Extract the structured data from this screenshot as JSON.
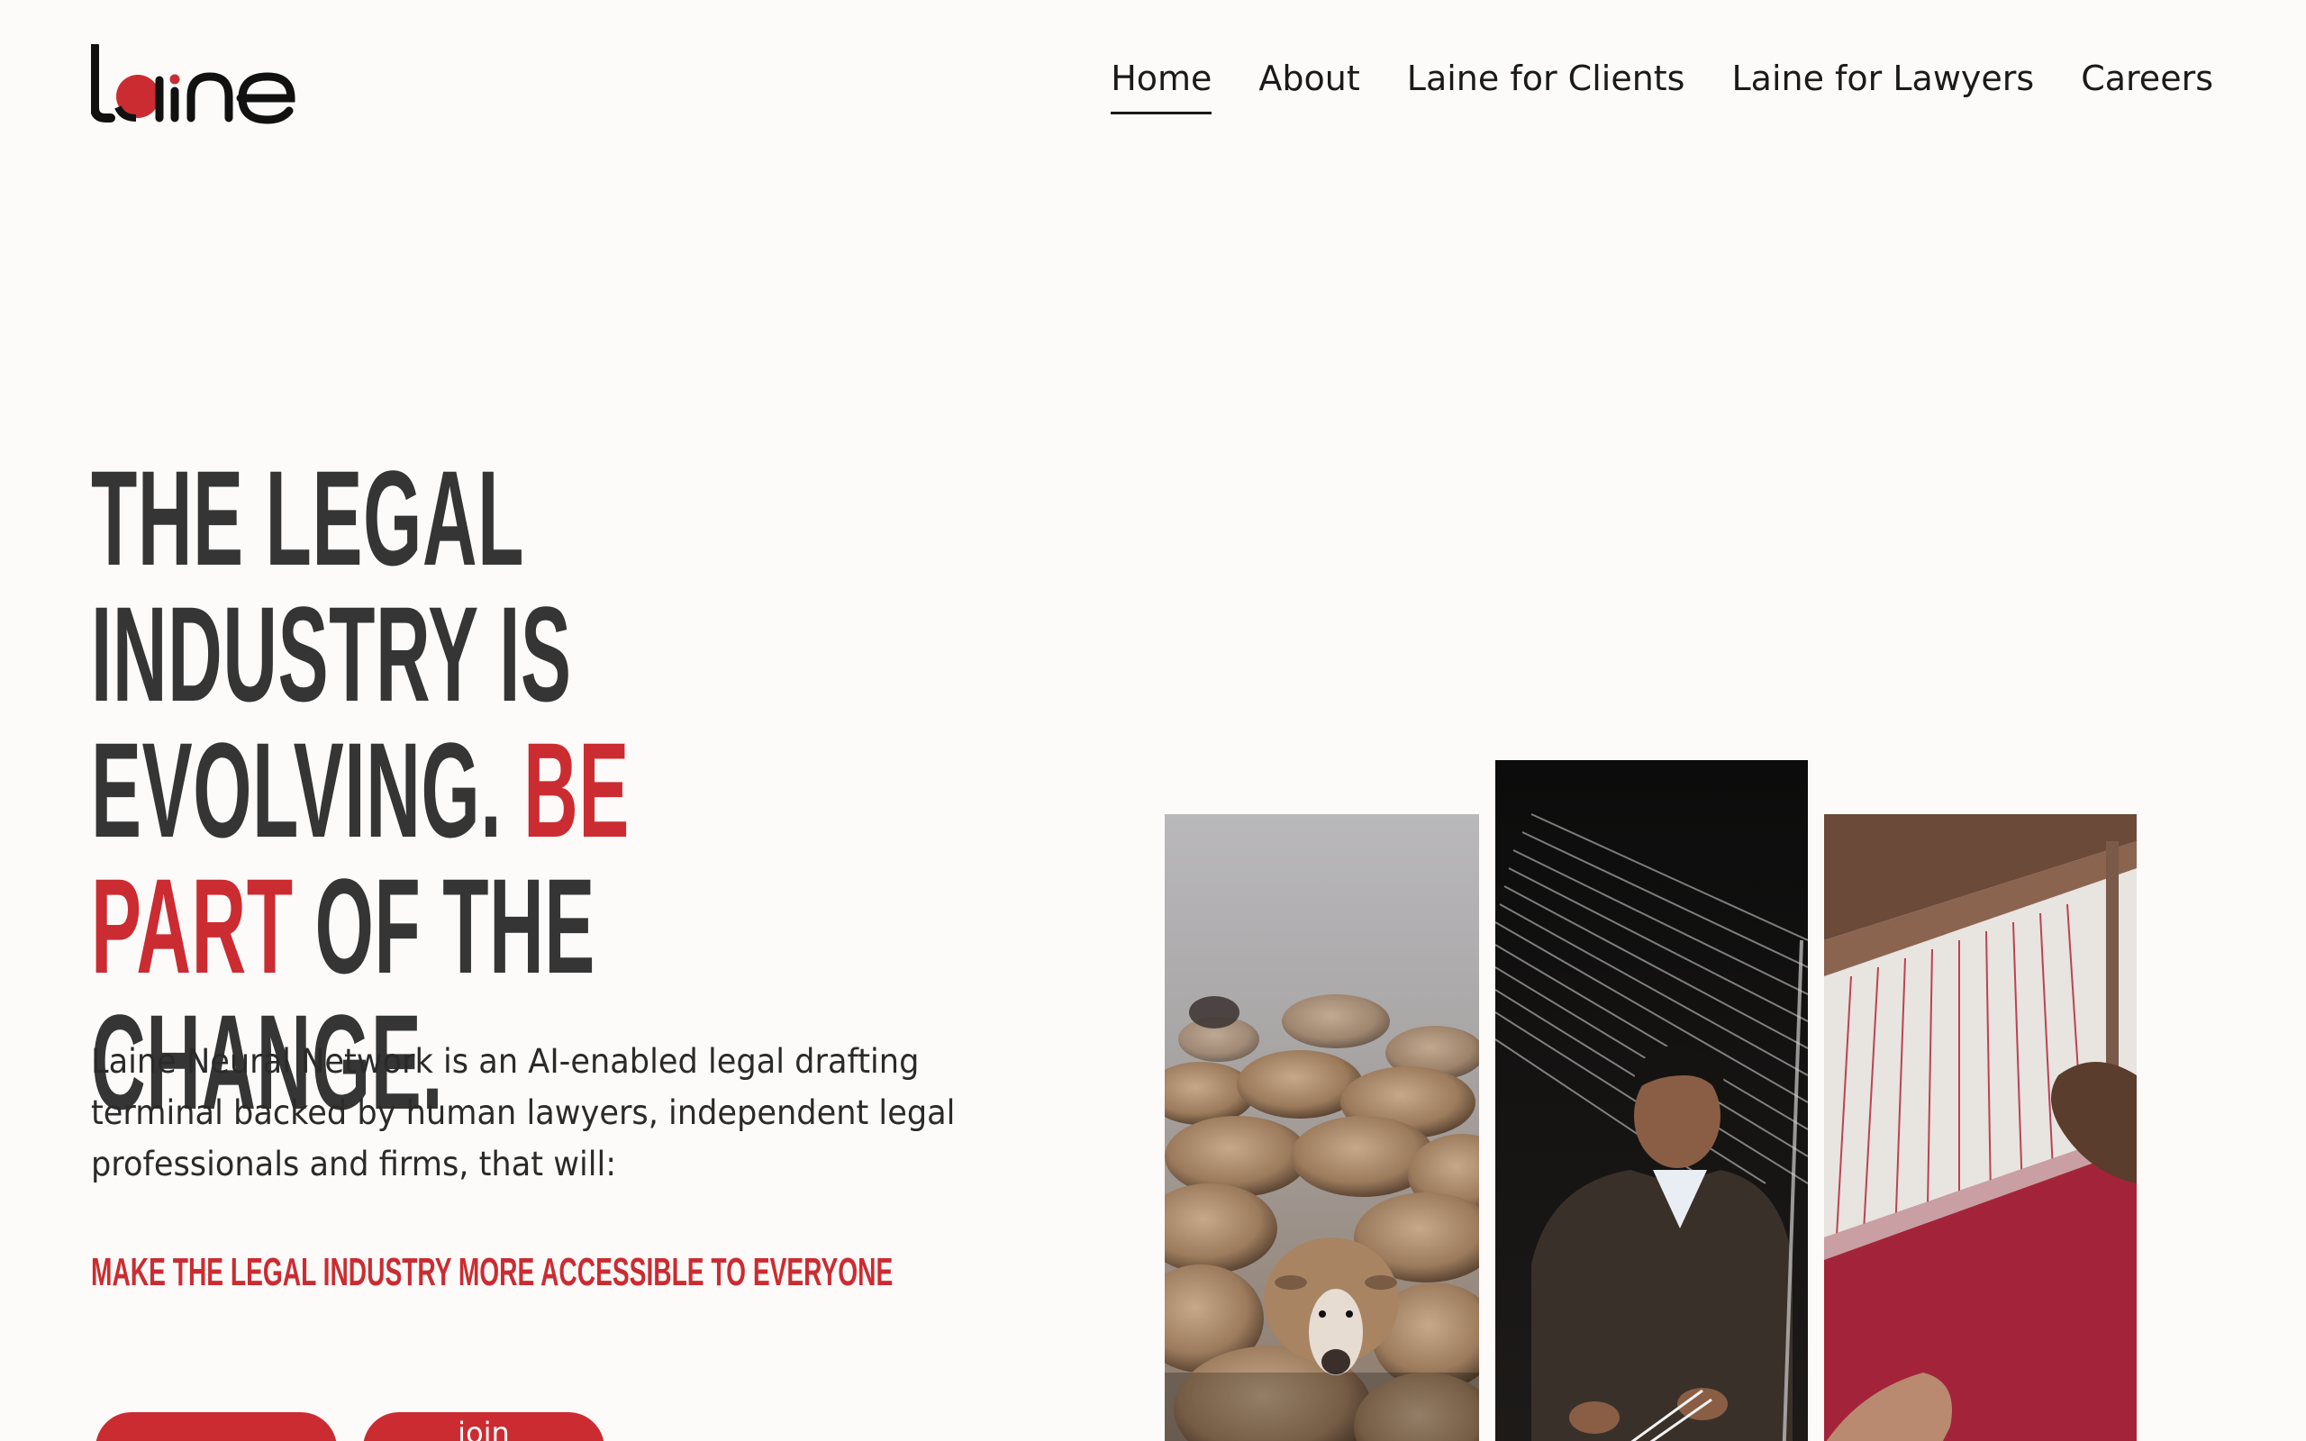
{
  "brand": {
    "name": "laine",
    "accent_color": "#cb2c31"
  },
  "nav": {
    "items": [
      {
        "label": "Home",
        "active": true
      },
      {
        "label": "About",
        "active": false
      },
      {
        "label": "Laine for Clients",
        "active": false
      },
      {
        "label": "Laine for Lawyers",
        "active": false
      },
      {
        "label": "Careers",
        "active": false
      }
    ]
  },
  "hero": {
    "title_part1": "THE LEGAL INDUSTRY IS EVOLVING.",
    "title_accent": "BE PART",
    "title_part2": "OF THE CHANGE.",
    "description": "Laine Neural Network is an AI-enabled legal drafting terminal backed by human lawyers, independent legal professionals and firms, that will:",
    "tagline": "MAKE THE LEGAL INDUSTRY MORE ACCESSIBLE TO EVERYONE",
    "buttons": [
      {
        "label": ""
      },
      {
        "label": "join"
      }
    ]
  },
  "images": [
    {
      "subject": "flock of sheep in fog"
    },
    {
      "subject": "man working at a loom"
    },
    {
      "subject": "hands weaving red threads on a loom"
    }
  ]
}
